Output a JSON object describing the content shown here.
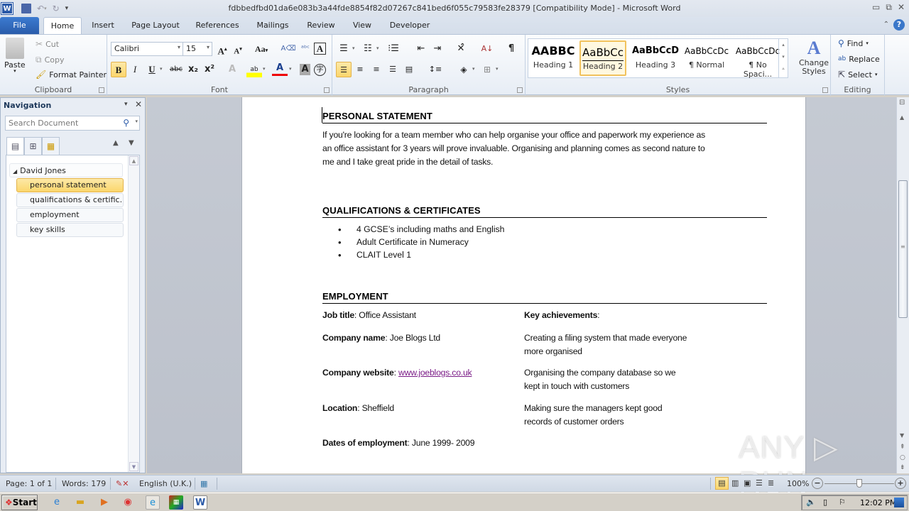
{
  "window": {
    "title": "fdbbedfbd01da6e083b3a44fde8854f82d07267c841bed6f055c79583fe28379 [Compatibility Mode]  -  Microsoft Word",
    "controls": [
      "minimize-icon",
      "restore-icon",
      "close-icon"
    ]
  },
  "tabs": [
    {
      "label": "File"
    },
    {
      "label": "Home"
    },
    {
      "label": "Insert"
    },
    {
      "label": "Page Layout"
    },
    {
      "label": "References"
    },
    {
      "label": "Mailings"
    },
    {
      "label": "Review"
    },
    {
      "label": "View"
    },
    {
      "label": "Developer"
    }
  ],
  "ribbon": {
    "clipboard": {
      "label": "Clipboard",
      "paste": "Paste",
      "cut": "Cut",
      "copy": "Copy",
      "format_painter": "Format Painter"
    },
    "font": {
      "label": "Font",
      "font_name": "Calibri",
      "font_size": "15",
      "change_case": "Aa",
      "bold": "B",
      "italic": "I",
      "underline": "U",
      "strike": "abc",
      "subscript": "x₂",
      "superscript": "x²"
    },
    "paragraph": {
      "label": "Paragraph",
      "pilcrow": "¶"
    },
    "styles": {
      "label": "Styles",
      "items": [
        {
          "preview": "AABBC",
          "name": "Heading 1"
        },
        {
          "preview": "AaBbCc",
          "name": "Heading 2",
          "selected": true
        },
        {
          "preview": "AaBbCcD",
          "name": "Heading 3"
        },
        {
          "preview": "AaBbCcDc",
          "name": "¶ Normal"
        },
        {
          "preview": "AaBbCcDc",
          "name": "¶ No Spaci..."
        }
      ],
      "change_styles": "Change Styles"
    },
    "editing": {
      "label": "Editing",
      "find": "Find",
      "replace": "Replace",
      "select": "Select"
    }
  },
  "navigation": {
    "title": "Navigation",
    "search_placeholder": "Search Document",
    "root": "David Jones",
    "items": [
      {
        "label": "personal statement",
        "selected": true
      },
      {
        "label": "qualifications & certific..."
      },
      {
        "label": "employment"
      },
      {
        "label": "key skills"
      }
    ]
  },
  "document": {
    "personal_statement": {
      "heading": "PERSONAL STATEMENT",
      "lines": [
        "If you're looking for a team member who can help organise your office and paperwork my experience as",
        "an office assistant for 3 years will prove invaluable. Organising and planning comes as second nature to",
        "me and I take great pride in the detail of tasks."
      ]
    },
    "qualifications": {
      "heading": "QUALIFICATIONS & CERTIFICATES",
      "items": [
        "4 GCSE’s including maths and English",
        "Adult Certificate in Numeracy",
        "CLAIT  Level 1"
      ]
    },
    "employment": {
      "heading": "EMPLOYMENT",
      "fields": [
        {
          "label": "Job title",
          "value": "Office Assistant"
        },
        {
          "label": "Company name",
          "value": "Joe Blogs Ltd"
        },
        {
          "label": "Company website",
          "value": "www.joeblogs.co.uk"
        },
        {
          "label": "Location",
          "value": "Sheffield"
        },
        {
          "label": "Dates of employment",
          "value": "June 1999- 2009"
        }
      ],
      "achievements_label": "Key achievements",
      "achievements": [
        [
          "Creating a filing system that made everyone",
          "more organised"
        ],
        [
          "Organising the company database so we",
          "kept in touch with customers"
        ],
        [
          "Making sure the managers kept good",
          "records of customer orders"
        ]
      ]
    }
  },
  "status": {
    "page": "Page: 1 of 1",
    "words": "Words: 179",
    "language": "English (U.K.)",
    "zoom": "100%",
    "zoom_percent": 100
  },
  "taskbar": {
    "start": "Start",
    "clock": "12:02 PM"
  },
  "watermark": "ANY ▷ RUN"
}
